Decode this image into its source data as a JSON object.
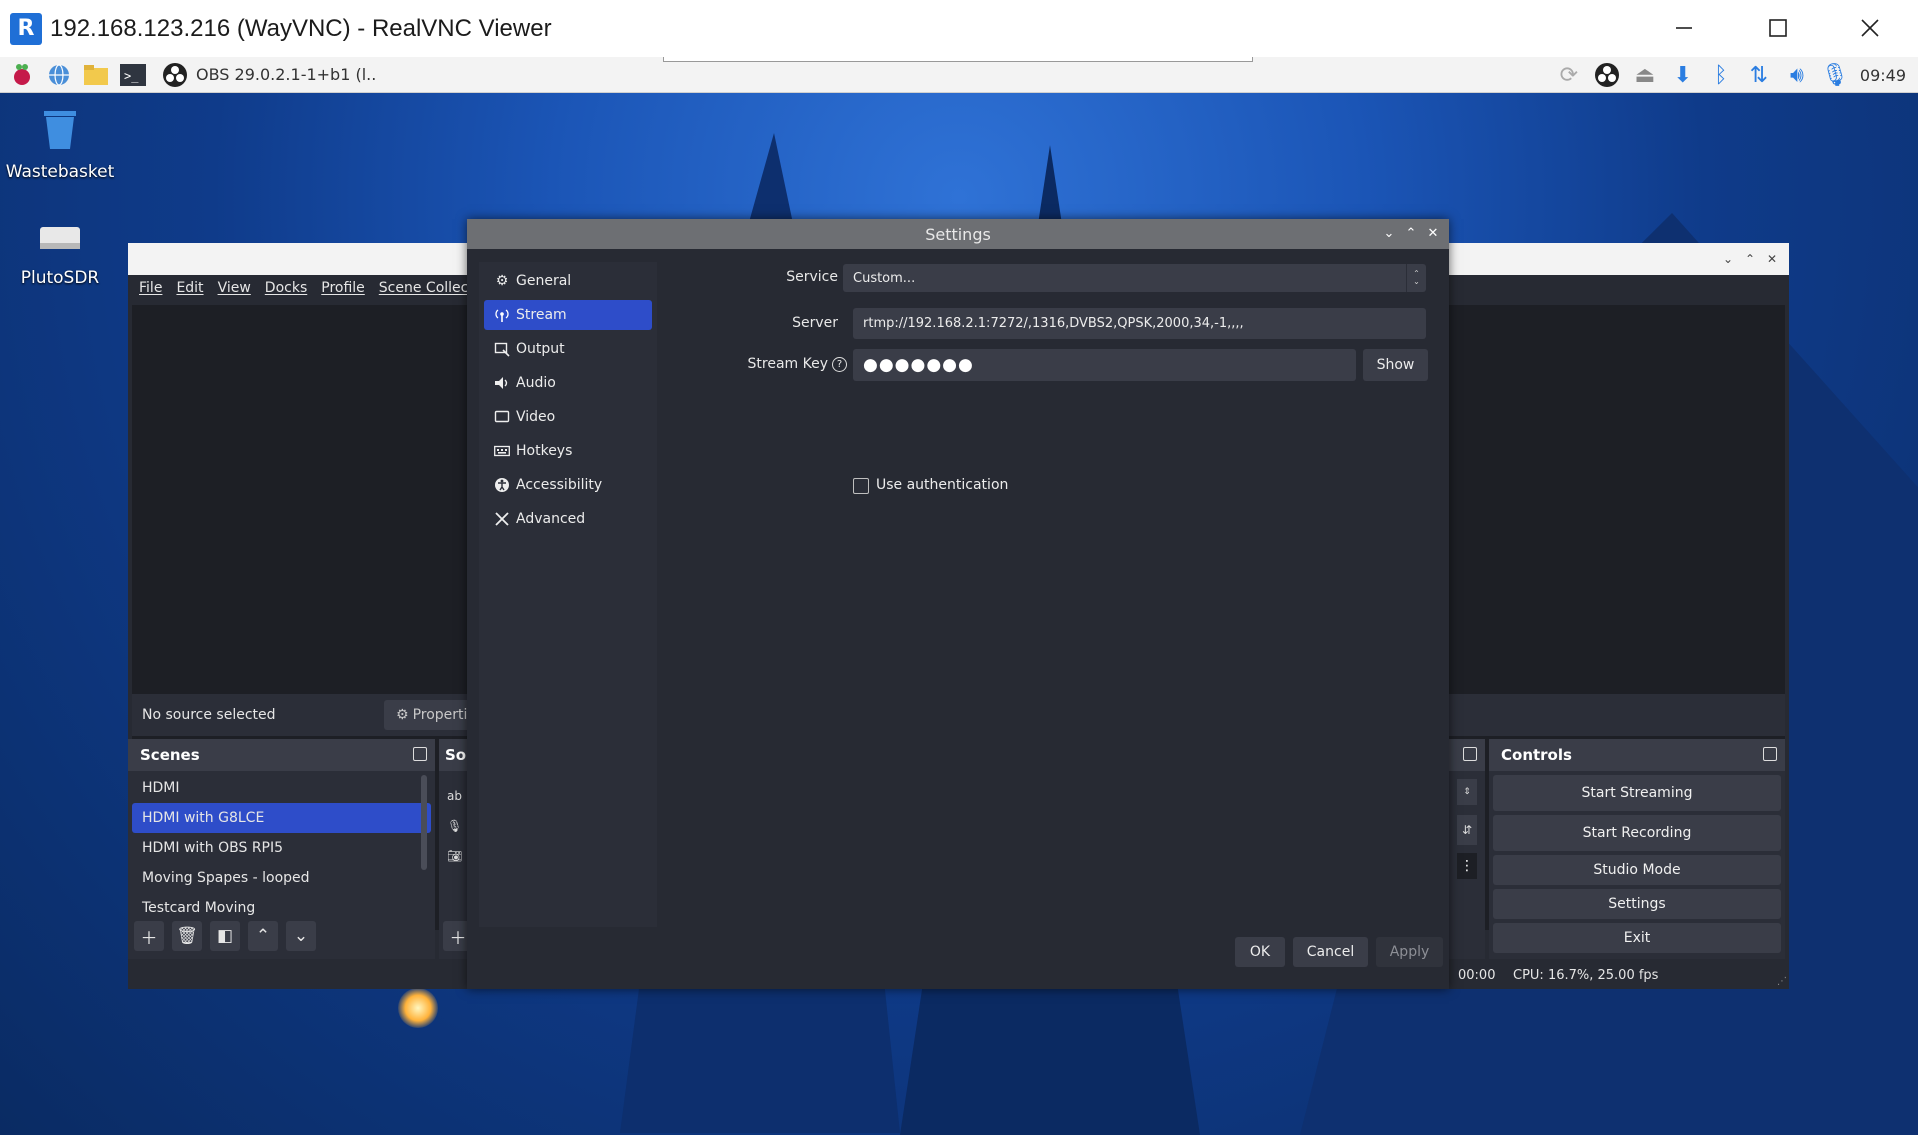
{
  "vnc": {
    "title": "192.168.123.216 (WayVNC) - RealVNC Viewer",
    "logo_text": "R"
  },
  "taskbar": {
    "obs_label": "OBS 29.0.2.1-1+b1 (l..",
    "clock": "09:49"
  },
  "desktop": {
    "items": [
      {
        "label": "Wastebasket",
        "icon": "wastebasket-icon"
      },
      {
        "label": "PlutoSDR",
        "icon": "drive-icon"
      }
    ]
  },
  "obs": {
    "menu": [
      "File",
      "Edit",
      "View",
      "Docks",
      "Profile",
      "Scene Collection"
    ],
    "no_source": "No source selected",
    "properties_label": "Properties",
    "scenes_title": "Scenes",
    "sources_title": "So",
    "scenes": [
      "HDMI",
      "HDMI with G8LCE",
      "HDMI with OBS RPI5",
      "Moving Spapes - looped",
      "Testcard Moving"
    ],
    "selected_scene_index": 1,
    "controls_title": "Controls",
    "controls": [
      "Start Streaming",
      "Start Recording",
      "Studio Mode",
      "Settings",
      "Exit"
    ],
    "status_time": "00:00",
    "status_cpu": "CPU: 16.7%, 25.00 fps"
  },
  "settings": {
    "title": "Settings",
    "nav": [
      {
        "label": "General",
        "icon": "gear-icon"
      },
      {
        "label": "Stream",
        "icon": "antenna-icon"
      },
      {
        "label": "Output",
        "icon": "output-icon"
      },
      {
        "label": "Audio",
        "icon": "speaker-icon"
      },
      {
        "label": "Video",
        "icon": "monitor-icon"
      },
      {
        "label": "Hotkeys",
        "icon": "keyboard-icon"
      },
      {
        "label": "Accessibility",
        "icon": "accessibility-icon"
      },
      {
        "label": "Advanced",
        "icon": "tools-icon"
      }
    ],
    "selected_nav": "Stream",
    "service_label": "Service",
    "service_value": "Custom...",
    "server_label": "Server",
    "server_value": "rtmp://192.168.2.1:7272/,1316,DVBS2,QPSK,2000,34,-1,,,,",
    "stream_key_label": "Stream Key",
    "stream_key_value": "●●●●●●●",
    "show_label": "Show",
    "use_auth_label": "Use authentication",
    "use_auth_checked": false,
    "ok_label": "OK",
    "cancel_label": "Cancel",
    "apply_label": "Apply"
  },
  "colors": {
    "obs_background": "#272a33",
    "selection": "#2e4dc9",
    "field": "#3a3d48"
  }
}
